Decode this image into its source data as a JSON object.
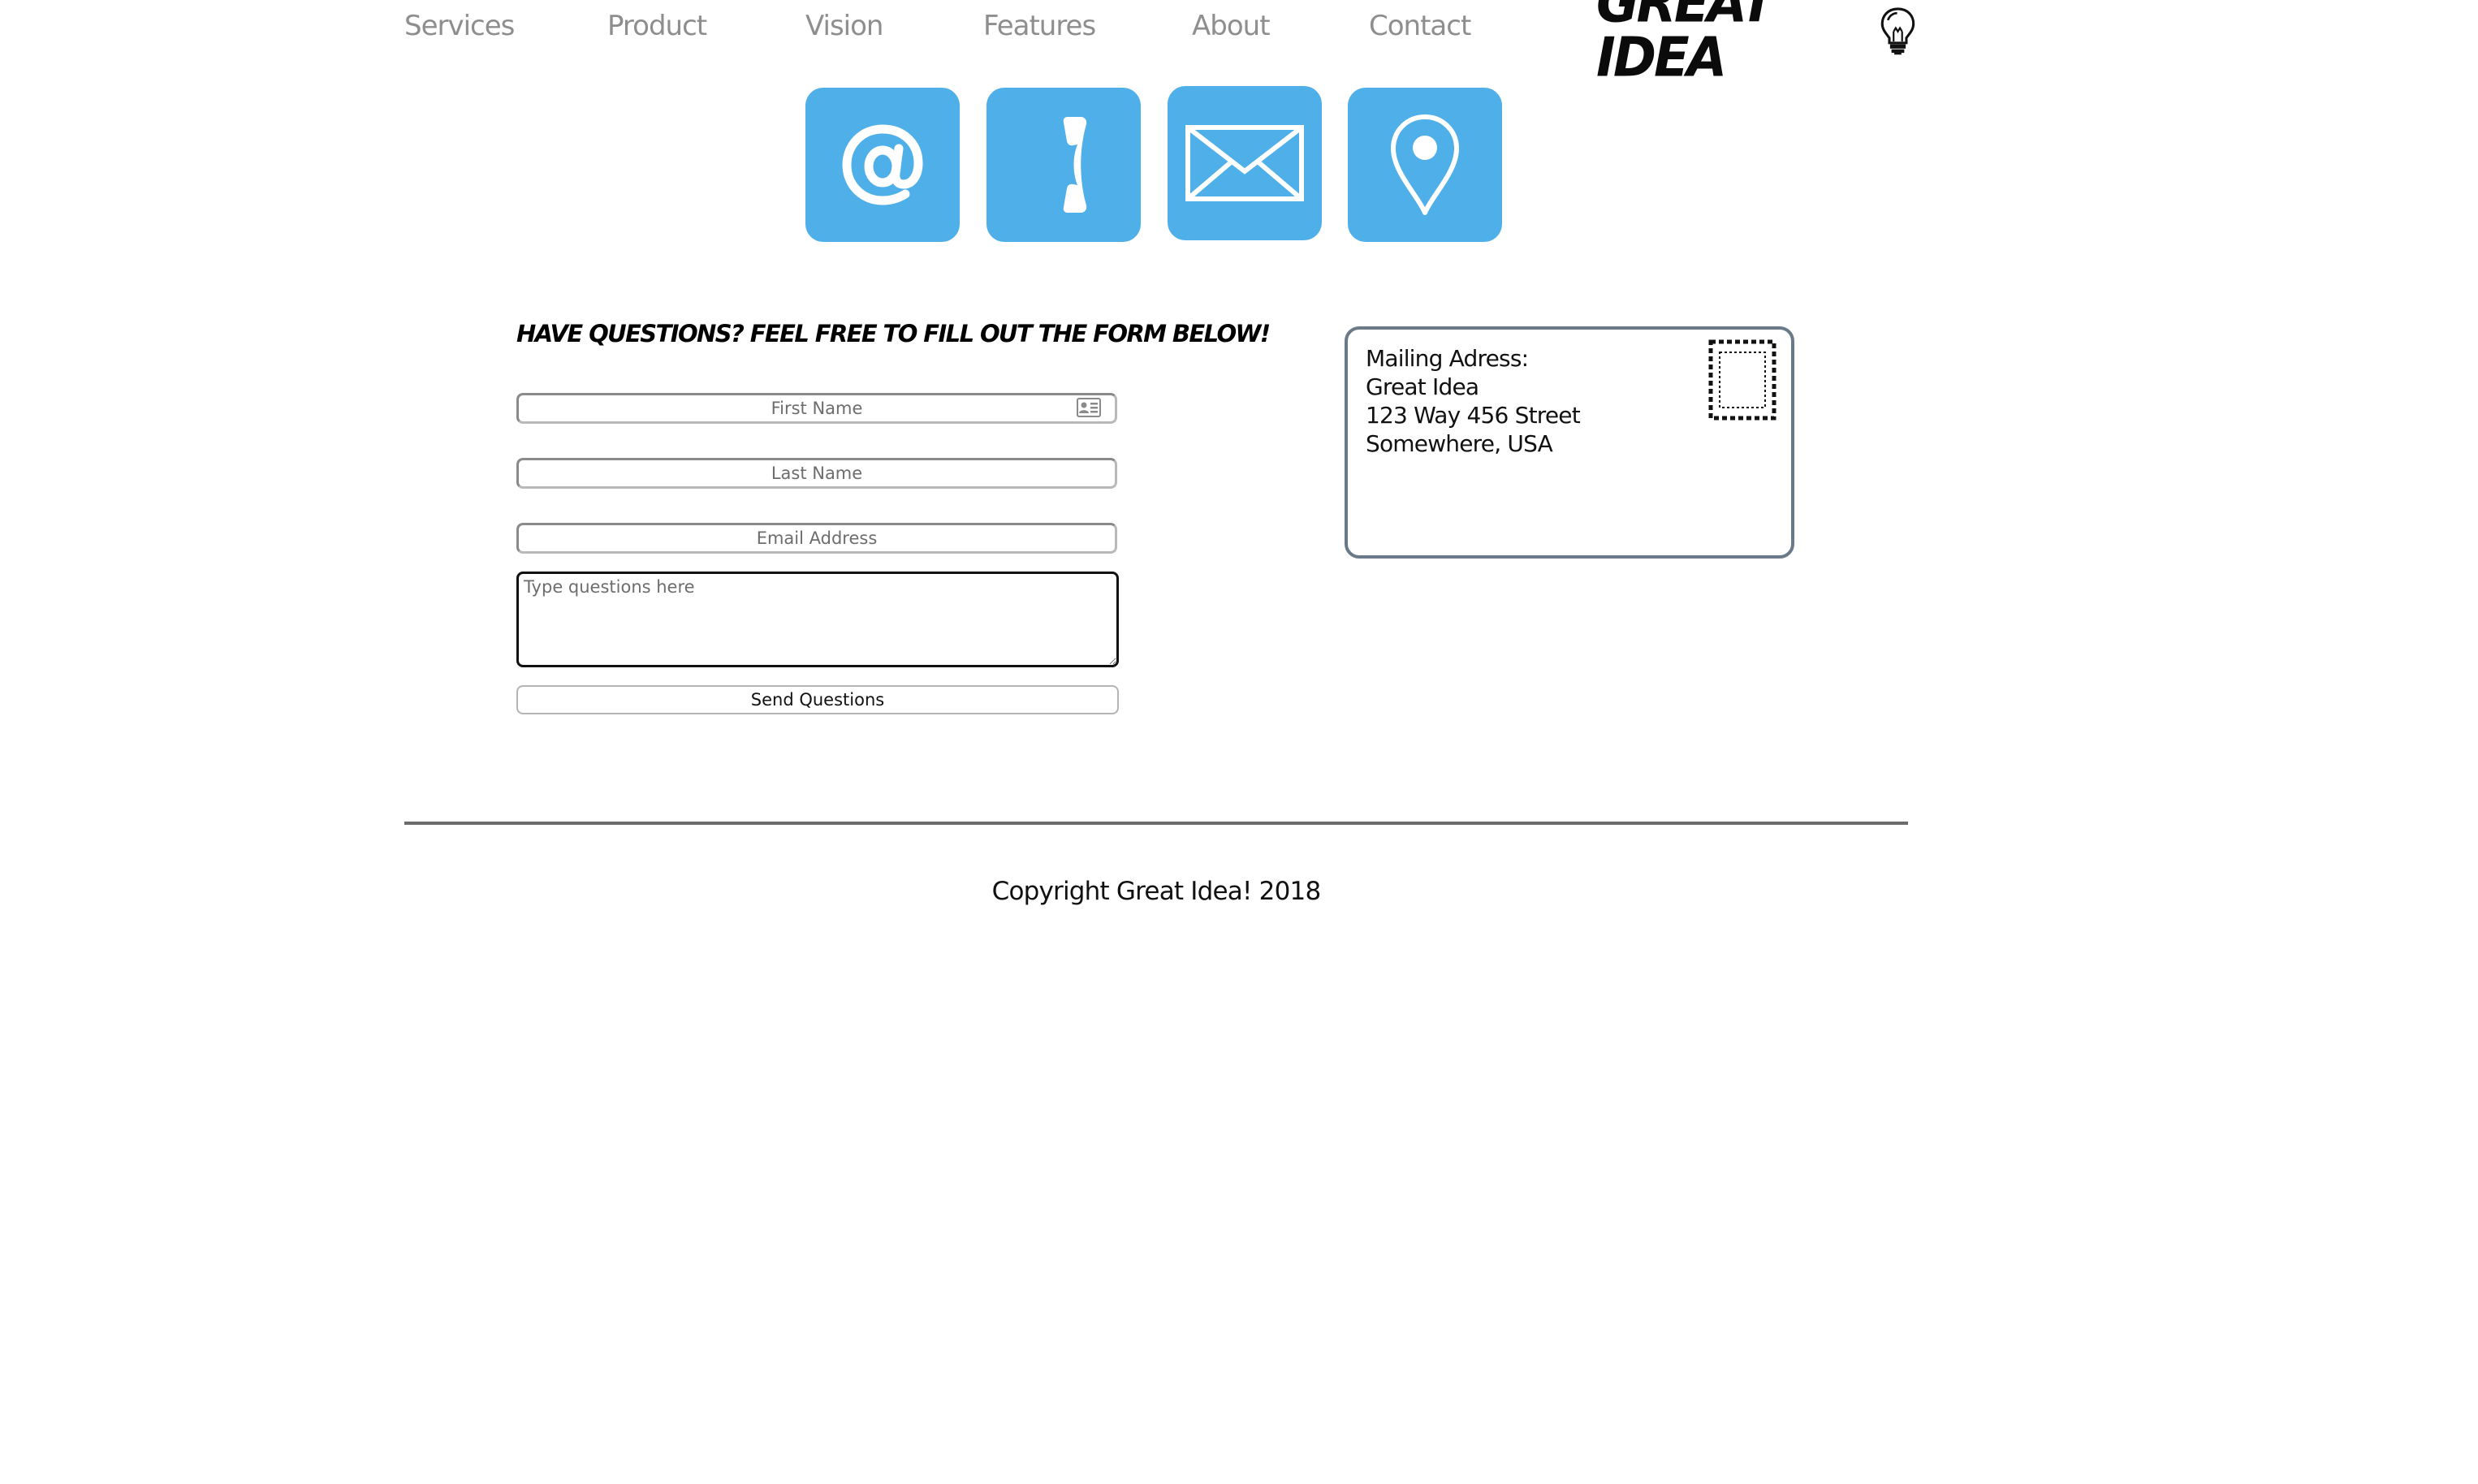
{
  "nav": {
    "items": [
      {
        "label": "Services"
      },
      {
        "label": "Product"
      },
      {
        "label": "Vision"
      },
      {
        "label": "Features"
      },
      {
        "label": "About"
      },
      {
        "label": "Contact"
      }
    ],
    "logo_text": "GREAT IDEA"
  },
  "contact_icons": [
    {
      "icon": "at-sign-icon"
    },
    {
      "icon": "phone-icon"
    },
    {
      "icon": "envelope-icon"
    },
    {
      "icon": "map-pin-icon"
    }
  ],
  "form": {
    "heading": "Have questions? Feel free to fill out the form below!",
    "first_name_placeholder": "First Name",
    "last_name_placeholder": "Last Name",
    "email_placeholder": "Email Address",
    "questions_placeholder": "Type questions here",
    "submit_label": "Send Questions"
  },
  "mailing": {
    "lines": [
      "Mailing Adress:",
      "Great Idea",
      "123 Way 456 Street",
      "Somewhere, USA"
    ]
  },
  "footer": {
    "copyright": "Copyright Great Idea! 2018"
  },
  "colors": {
    "tile": "#4fafe9",
    "nav_text": "#8e8e8e",
    "card_border": "#6b7a88"
  }
}
